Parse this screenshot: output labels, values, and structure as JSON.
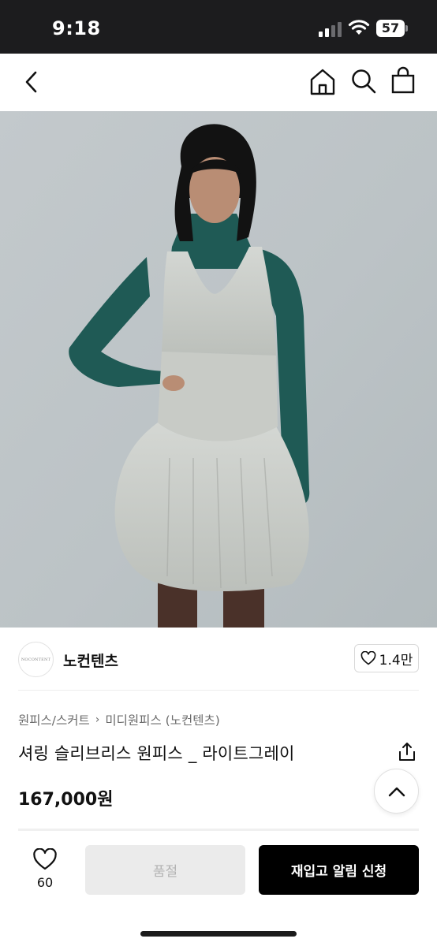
{
  "status_bar": {
    "time": "9:18",
    "battery": "57"
  },
  "nav": {
    "icons": [
      "chevron-left-icon",
      "home-icon",
      "search-icon",
      "shopping-bag-icon"
    ]
  },
  "seller": {
    "logo_text": "NOCONTENT",
    "name": "노컨텐츠",
    "likes": "1.4만"
  },
  "product": {
    "breadcrumb": [
      "원피스/스커트",
      "미디원피스 (노컨텐츠)"
    ],
    "title": "셔링 슬리브리스 원피스 _ 라이트그레이",
    "price": "167,000원"
  },
  "bottom_bar": {
    "wish_count": "60",
    "soldout_label": "품절",
    "restock_label": "재입고 알림 신청"
  },
  "colors": {
    "accent": "#000000",
    "soldout_bg": "#ebebeb",
    "turtleneck": "#1f5a55",
    "dress": "#c9ccc8",
    "wall": "#c3c9cc"
  }
}
